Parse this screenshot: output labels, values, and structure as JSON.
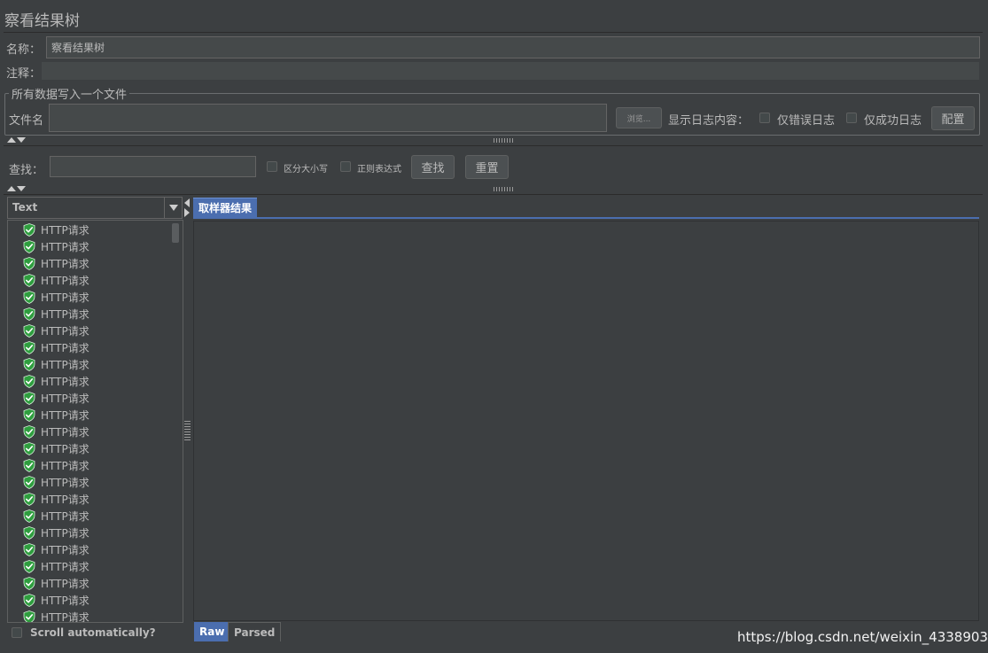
{
  "panel_title": "察看结果树",
  "name_row": {
    "label": "名称：",
    "value": "察看结果树"
  },
  "comment_row": {
    "label": "注释：",
    "value": ""
  },
  "file_group": {
    "title": "所有数据写入一个文件",
    "file_label": "文件名",
    "file_value": "",
    "browse_label": "浏览...",
    "log_display_label": "显示日志内容：",
    "errors_only_label": "仅错误日志",
    "success_only_label": "仅成功日志",
    "configure_label": "配置"
  },
  "search": {
    "label": "查找：",
    "value": "",
    "case_sensitive_label": "区分大小写",
    "regex_label": "正则表达式",
    "find_label": "查找",
    "reset_label": "重置"
  },
  "renderer": {
    "selected": "Text"
  },
  "tree": {
    "items": [
      {
        "label": "HTTP请求",
        "status": "success"
      },
      {
        "label": "HTTP请求",
        "status": "success"
      },
      {
        "label": "HTTP请求",
        "status": "success"
      },
      {
        "label": "HTTP请求",
        "status": "success"
      },
      {
        "label": "HTTP请求",
        "status": "success"
      },
      {
        "label": "HTTP请求",
        "status": "success"
      },
      {
        "label": "HTTP请求",
        "status": "success"
      },
      {
        "label": "HTTP请求",
        "status": "success"
      },
      {
        "label": "HTTP请求",
        "status": "success"
      },
      {
        "label": "HTTP请求",
        "status": "success"
      },
      {
        "label": "HTTP请求",
        "status": "success"
      },
      {
        "label": "HTTP请求",
        "status": "success"
      },
      {
        "label": "HTTP请求",
        "status": "success"
      },
      {
        "label": "HTTP请求",
        "status": "success"
      },
      {
        "label": "HTTP请求",
        "status": "success"
      },
      {
        "label": "HTTP请求",
        "status": "success"
      },
      {
        "label": "HTTP请求",
        "status": "success"
      },
      {
        "label": "HTTP请求",
        "status": "success"
      },
      {
        "label": "HTTP请求",
        "status": "success"
      },
      {
        "label": "HTTP请求",
        "status": "success"
      },
      {
        "label": "HTTP请求",
        "status": "success"
      },
      {
        "label": "HTTP请求",
        "status": "success"
      },
      {
        "label": "HTTP请求",
        "status": "success"
      },
      {
        "label": "HTTP请求",
        "status": "success"
      }
    ]
  },
  "scroll_auto_label": "Scroll automatically?",
  "result_tabs": {
    "sampler_result": "取样器结果"
  },
  "view_tabs": {
    "raw": "Raw",
    "parsed": "Parsed"
  },
  "watermark": "https://blog.csdn.net/weixin_43389036",
  "colors": {
    "background": "#3c3f41",
    "accent": "#4b6eaf",
    "success_icon": "#2e9e3e"
  }
}
